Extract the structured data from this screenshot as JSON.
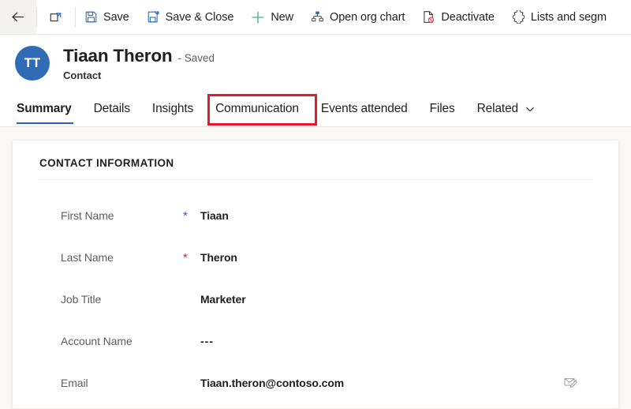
{
  "commandbar": {
    "items": [
      {
        "name": "back",
        "icon": "back-arrow-icon",
        "label": ""
      },
      {
        "name": "popout",
        "icon": "open-in-new-window-icon",
        "label": ""
      },
      {
        "name": "save",
        "icon": "save-icon",
        "label": "Save"
      },
      {
        "name": "save-and-close",
        "icon": "save-and-close-icon",
        "label": "Save & Close"
      },
      {
        "name": "new",
        "icon": "plus-icon",
        "label": "New"
      },
      {
        "name": "open-org-chart",
        "icon": "org-chart-icon",
        "label": "Open org chart"
      },
      {
        "name": "deactivate",
        "icon": "deactivate-icon",
        "label": "Deactivate"
      },
      {
        "name": "lists-and-segments",
        "icon": "puzzle-icon",
        "label": "Lists and segm"
      }
    ]
  },
  "record": {
    "avatar_initials": "TT",
    "title": "Tiaan Theron",
    "state": "- Saved",
    "subtitle": "Contact",
    "avatar_color": "#2f6cb5"
  },
  "tabs": {
    "items": [
      {
        "label": "Summary",
        "active": true
      },
      {
        "label": "Details",
        "active": false
      },
      {
        "label": "Insights",
        "active": false
      },
      {
        "label": "Communication",
        "active": false,
        "highlighted": true
      },
      {
        "label": "Events attended",
        "active": false
      },
      {
        "label": "Files",
        "active": false
      },
      {
        "label": "Related",
        "active": false,
        "caret": true
      }
    ],
    "highlight_color": "#e8192c",
    "active_underline_color": "#2266cc"
  },
  "form": {
    "section_title": "CONTACT INFORMATION",
    "fields": [
      {
        "label": "First Name",
        "required": "recommended",
        "value": "Tiaan"
      },
      {
        "label": "Last Name",
        "required": "required",
        "value": "Theron"
      },
      {
        "label": "Job Title",
        "required": "none",
        "value": "Marketer"
      },
      {
        "label": "Account Name",
        "required": "none",
        "value": "---"
      },
      {
        "label": "Email",
        "required": "none",
        "value": "Tiaan.theron@contoso.com",
        "action_icon": "email-compose-icon"
      }
    ]
  }
}
